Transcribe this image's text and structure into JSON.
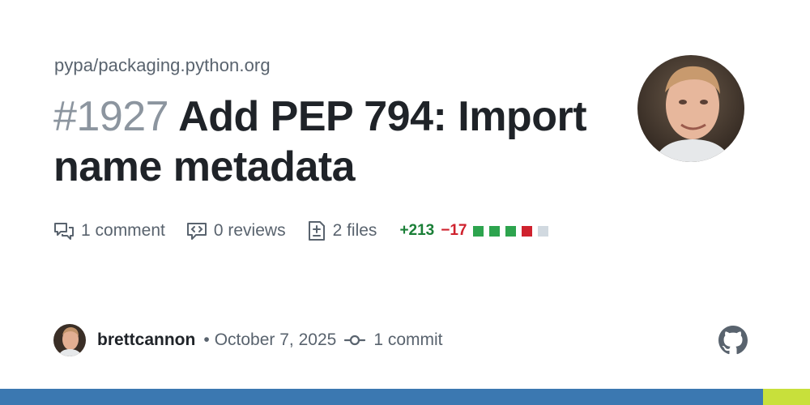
{
  "repo": "pypa/packaging.python.org",
  "pr": {
    "number": "#1927",
    "title": "Add PEP 794: Import name metadata"
  },
  "stats": {
    "comments": "1 comment",
    "reviews": "0 reviews",
    "files": "2 files",
    "additions": "+213",
    "deletions": "−17",
    "diff_blocks": [
      "green",
      "green",
      "green",
      "red",
      "gray"
    ]
  },
  "footer": {
    "author": "brettcannon",
    "separator": "•",
    "date": "October 7, 2025",
    "commits": "1 commit"
  },
  "colors": {
    "additions": "#1a7f37",
    "deletions": "#cf222e",
    "bar_blue": "#3b78b1",
    "bar_green": "#c8e03b"
  }
}
